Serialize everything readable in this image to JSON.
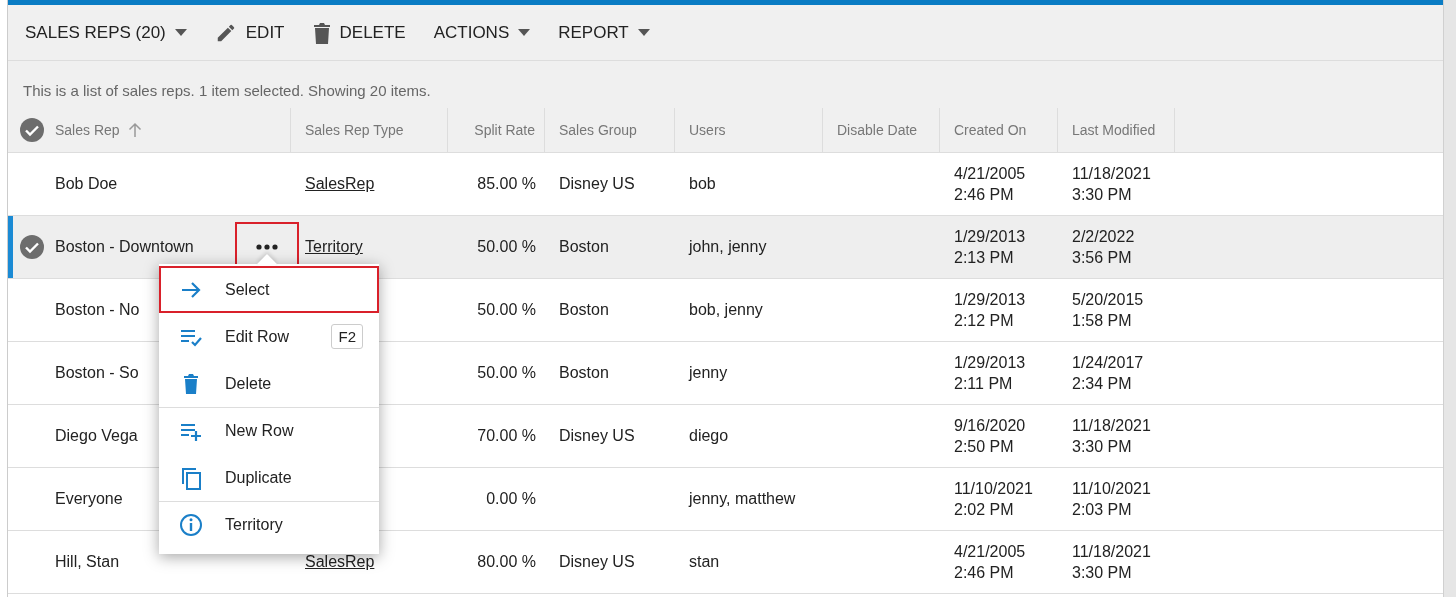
{
  "toolbar": {
    "items": [
      {
        "label": "SALES REPS (20)",
        "kind": "dropdown"
      },
      {
        "label": "EDIT",
        "kind": "pencil"
      },
      {
        "label": "DELETE",
        "kind": "trash"
      },
      {
        "label": "ACTIONS",
        "kind": "dropdown"
      },
      {
        "label": "REPORT",
        "kind": "dropdown"
      }
    ]
  },
  "description": "This is a list of sales reps. 1 item selected. Showing 20 items.",
  "table": {
    "columns": [
      {
        "label": "Sales Rep",
        "sorted": true
      },
      {
        "label": "Sales Rep Type"
      },
      {
        "label": "Split Rate"
      },
      {
        "label": "Sales Group"
      },
      {
        "label": "Users"
      },
      {
        "label": "Disable Date"
      },
      {
        "label": "Created On"
      },
      {
        "label": "Last Modified"
      }
    ],
    "rows": [
      {
        "selected": false,
        "menu_open": false,
        "sales_rep": "Bob Doe",
        "type": "SalesRep",
        "split_rate": "85.00 %",
        "group": "Disney US",
        "users": "bob",
        "created_on": [
          "4/21/2005",
          "2:46 PM"
        ],
        "last_modified": [
          "11/18/2021",
          "3:30 PM"
        ]
      },
      {
        "selected": true,
        "menu_open": true,
        "sales_rep": "Boston - Downtown",
        "type": "Territory",
        "split_rate": "50.00 %",
        "group": "Boston",
        "users": "john, jenny",
        "created_on": [
          "1/29/2013",
          "2:13 PM"
        ],
        "last_modified": [
          "2/2/2022",
          "3:56 PM"
        ]
      },
      {
        "selected": false,
        "menu_open": false,
        "sales_rep": "Boston - No",
        "split_rate": "50.00 %",
        "group": "Boston",
        "users": "bob, jenny",
        "created_on": [
          "1/29/2013",
          "2:12 PM"
        ],
        "last_modified": [
          "5/20/2015",
          "1:58 PM"
        ]
      },
      {
        "selected": false,
        "menu_open": false,
        "sales_rep": "Boston - So",
        "split_rate": "50.00 %",
        "group": "Boston",
        "users": "jenny",
        "created_on": [
          "1/29/2013",
          "2:11 PM"
        ],
        "last_modified": [
          "1/24/2017",
          "2:34 PM"
        ]
      },
      {
        "selected": false,
        "menu_open": false,
        "sales_rep": "Diego Vega",
        "split_rate": "70.00 %",
        "group": "Disney US",
        "users": "diego",
        "created_on": [
          "9/16/2020",
          "2:50 PM"
        ],
        "last_modified": [
          "11/18/2021",
          "3:30 PM"
        ]
      },
      {
        "selected": false,
        "menu_open": false,
        "sales_rep": "Everyone",
        "split_rate": "0.00 %",
        "users": "jenny, matthew",
        "created_on": [
          "11/10/2021",
          "2:02 PM"
        ],
        "last_modified": [
          "11/10/2021",
          "2:03 PM"
        ]
      },
      {
        "selected": false,
        "menu_open": false,
        "sales_rep": "Hill, Stan",
        "type": "SalesRep",
        "split_rate": "80.00 %",
        "group": "Disney US",
        "users": "stan",
        "created_on": [
          "4/21/2005",
          "2:46 PM"
        ],
        "last_modified": [
          "11/18/2021",
          "3:30 PM"
        ]
      }
    ]
  },
  "row_menu": {
    "button_annotated": true,
    "items": [
      {
        "label": "Select",
        "kind": "arrow",
        "annotated": true,
        "separator_above": false
      },
      {
        "label": "Edit Row",
        "kind": "edit",
        "shortcut": "F2",
        "annotated": false,
        "separator_above": false
      },
      {
        "label": "Delete",
        "kind": "trash",
        "annotated": false,
        "separator_above": false
      },
      {
        "label": "New Row",
        "kind": "add",
        "annotated": false,
        "separator_above": true
      },
      {
        "label": "Duplicate",
        "kind": "copy",
        "annotated": false,
        "separator_above": false
      },
      {
        "label": "Territory",
        "kind": "info",
        "annotated": false,
        "separator_above": true
      }
    ]
  }
}
